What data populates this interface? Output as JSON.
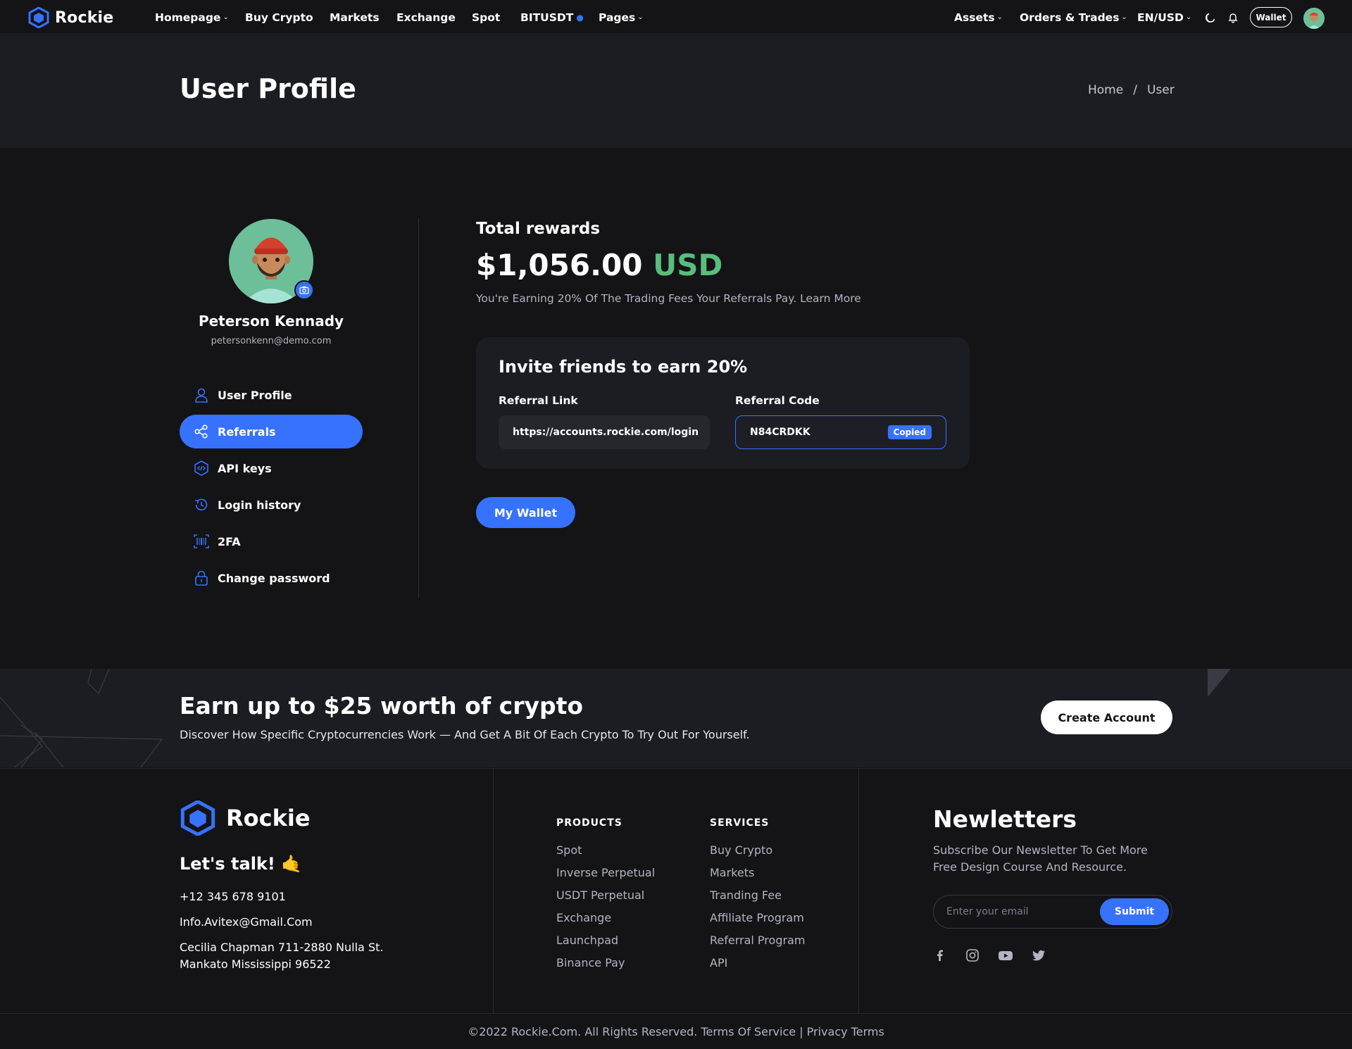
{
  "header": {
    "logo_text": "Rockie",
    "nav": [
      {
        "label": "Homepage",
        "dropdown": true
      },
      {
        "label": "Buy Crypto",
        "dropdown": false
      },
      {
        "label": "Markets",
        "dropdown": false
      },
      {
        "label": "Exchange",
        "dropdown": false
      },
      {
        "label": "Spot",
        "dropdown": false
      },
      {
        "label": "BITUSDT",
        "dropdown": false
      },
      {
        "label": "Pages",
        "dropdown": true
      }
    ],
    "right_nav": {
      "assets": "Assets",
      "orders": "Orders & Trades",
      "currency": "EN/USD"
    },
    "wallet_label": "Wallet"
  },
  "page": {
    "title": "User Profile",
    "breadcrumb": {
      "home": "Home",
      "separator": "/",
      "current": "User"
    }
  },
  "profile": {
    "name": "Peterson Kennady",
    "email": "petersonkenn@demo.com",
    "menu": [
      {
        "label": "User Profile",
        "icon": "user-icon",
        "active": false
      },
      {
        "label": "Referrals",
        "icon": "share-icon",
        "active": true
      },
      {
        "label": "API keys",
        "icon": "code-icon",
        "active": false
      },
      {
        "label": "Login history",
        "icon": "history-icon",
        "active": false
      },
      {
        "label": "2FA",
        "icon": "barcode-icon",
        "active": false
      },
      {
        "label": "Change password",
        "icon": "lock-icon",
        "active": false
      }
    ]
  },
  "rewards": {
    "label": "Total rewards",
    "amount": "$1,056.00",
    "currency": "USD",
    "description": "You're Earning 20% Of The Trading Fees Your Referrals Pay. Learn More"
  },
  "invite": {
    "title": "Invite friends to earn 20%",
    "link_label": "Referral Link",
    "link_value": "https://accounts.rockie.com/login",
    "code_label": "Referral Code",
    "code_value": "N84CRDKK",
    "copied_badge": "Copied"
  },
  "wallet_button": "My Wallet",
  "cta": {
    "title": "Earn up to $25 worth of crypto",
    "description": "Discover How Specific Cryptocurrencies Work — And Get A Bit Of Each Crypto To Try Out For Yourself.",
    "button": "Create Account"
  },
  "footer": {
    "logo_text": "Rockie",
    "talk": "Let's talk! 🤙",
    "phone": "+12 345 678 9101",
    "email": "Info.Avitex@Gmail.Com",
    "address_line1": "Cecilia Chapman 711-2880 Nulla St.",
    "address_line2": "Mankato Mississippi 96522",
    "products": {
      "heading": "PRODUCTS",
      "items": [
        "Spot",
        "Inverse Perpetual",
        "USDT Perpetual",
        "Exchange",
        "Launchpad",
        "Binance Pay"
      ]
    },
    "services": {
      "heading": "SERVICES",
      "items": [
        "Buy Crypto",
        "Markets",
        "Tranding Fee",
        "Affiliate Program",
        "Referral Program",
        "API"
      ]
    },
    "newsletter": {
      "title": "Newletters",
      "description": "Subscribe Our Newsletter To Get More Free Design Course And Resource.",
      "placeholder": "Enter your email",
      "submit": "Submit"
    },
    "socials": [
      "facebook-icon",
      "instagram-icon",
      "youtube-icon",
      "twitter-icon"
    ],
    "copyright": "©2022 Rockie.Com. All Rights Reserved. Terms Of Service |  Privacy Terms"
  },
  "colors": {
    "accent": "#3772ff",
    "positive": "#58bd7d",
    "background": "#141416",
    "surface": "#1c1d22"
  }
}
